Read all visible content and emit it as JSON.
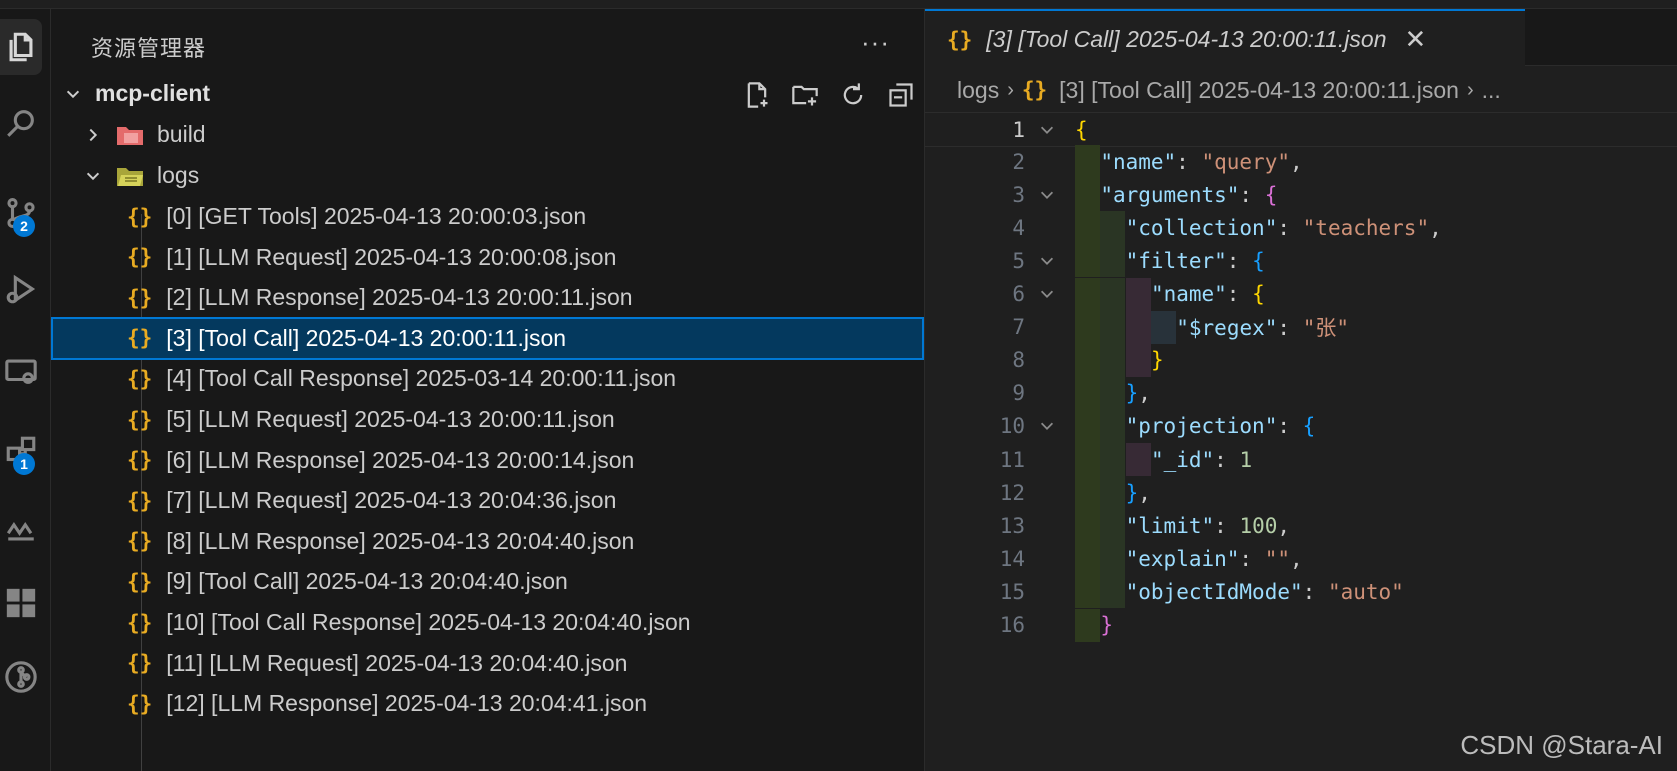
{
  "explorer": {
    "title": "资源管理器",
    "more": "···",
    "root": "mcp-client",
    "folders": [
      {
        "label": "build",
        "expanded": false,
        "color": "#e46b6b"
      },
      {
        "label": "logs",
        "expanded": true,
        "color": "#c7c450"
      }
    ],
    "files": [
      "[0] [GET Tools] 2025-04-13 20:00:03.json",
      "[1] [LLM Request] 2025-04-13 20:00:08.json",
      "[2] [LLM Response] 2025-04-13 20:00:11.json",
      "[3] [Tool Call] 2025-04-13 20:00:11.json",
      "[4] [Tool Call Response] 2025-03-14 20:00:11.json",
      "[5] [LLM Request] 2025-04-13 20:00:11.json",
      "[6] [LLM Response] 2025-04-13 20:00:14.json",
      "[7] [LLM Request] 2025-04-13 20:04:36.json",
      "[8] [LLM Response] 2025-04-13 20:04:40.json",
      "[9] [Tool Call] 2025-04-13 20:04:40.json",
      "[10] [Tool Call Response] 2025-04-13 20:04:40.json",
      "[11] [LLM Request] 2025-04-13 20:04:40.json",
      "[12] [LLM Response] 2025-04-13 20:04:41.json"
    ],
    "selected_index": 3,
    "file_icon": "{}",
    "toolbar_icons": [
      "new-file-icon",
      "new-folder-icon",
      "refresh-icon",
      "collapse-all-icon"
    ]
  },
  "activity_bar": {
    "items": [
      {
        "name": "explorer-icon",
        "active": true
      },
      {
        "name": "search-icon"
      },
      {
        "name": "source-control-icon",
        "badge": "2"
      },
      {
        "name": "run-debug-icon"
      },
      {
        "name": "remote-explorer-icon"
      },
      {
        "name": "testing-icon",
        "badge": "1"
      },
      {
        "name": "database-icon"
      },
      {
        "name": "extensions-icon"
      },
      {
        "name": "git-graph-icon"
      }
    ]
  },
  "editor": {
    "tab": {
      "icon": "{}",
      "title": "[3] [Tool Call] 2025-04-13 20:00:11.json",
      "close": "✕"
    },
    "breadcrumb": {
      "folder": "logs",
      "file": "[3] [Tool Call] 2025-04-13 20:00:11.json",
      "more": "..."
    },
    "current_line": 1,
    "lines": [
      "{",
      "  \"name\": \"query\",",
      "  \"arguments\": {",
      "    \"collection\": \"teachers\",",
      "    \"filter\": {",
      "      \"name\": {",
      "        \"$regex\": \"张\"",
      "      }",
      "    },",
      "    \"projection\": {",
      "      \"_id\": 1",
      "    },",
      "    \"limit\": 100,",
      "    \"explain\": \"\",",
      "    \"objectIdMode\": \"auto\"",
      "  }"
    ],
    "line_numbers": [
      "1",
      "2",
      "3",
      "4",
      "5",
      "6",
      "7",
      "8",
      "9",
      "10",
      "11",
      "12",
      "13",
      "14",
      "15",
      "16"
    ]
  },
  "watermark": "CSDN @Stara-AI",
  "colors": {
    "accent": "#0078d4",
    "selection": "#04395e",
    "json_icon": "#e8ab22"
  }
}
